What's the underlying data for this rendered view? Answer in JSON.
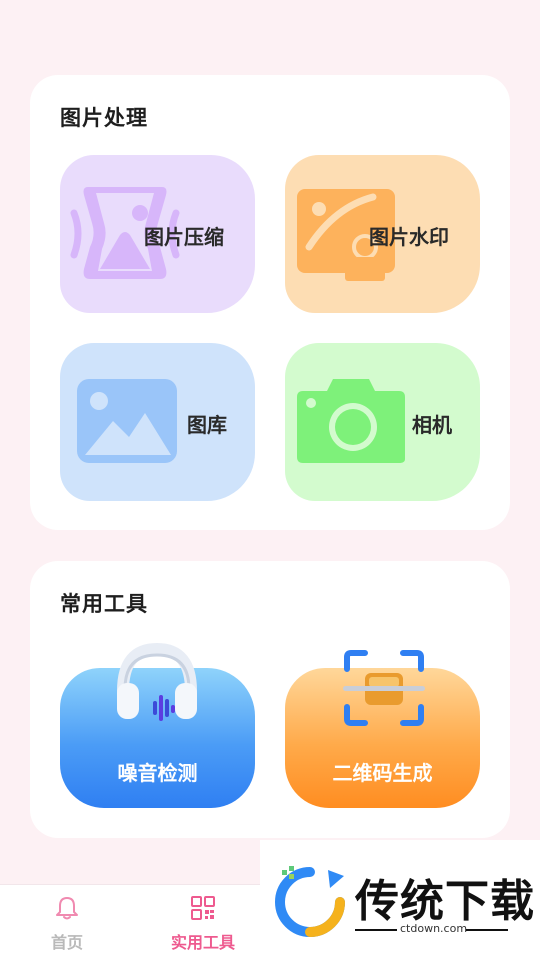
{
  "sections": {
    "image_processing": {
      "title": "图片处理",
      "tiles": [
        {
          "label": "图片压缩",
          "icon": "image-compress-icon"
        },
        {
          "label": "图片水印",
          "icon": "image-watermark-icon"
        },
        {
          "label": "图库",
          "icon": "gallery-icon"
        },
        {
          "label": "相机",
          "icon": "camera-icon"
        }
      ]
    },
    "common_tools": {
      "title": "常用工具",
      "tools": [
        {
          "label": "噪音检测",
          "icon": "headphones-icon"
        },
        {
          "label": "二维码生成",
          "icon": "qr-scan-icon"
        }
      ]
    }
  },
  "bottom_nav": {
    "items": [
      {
        "label": "首页",
        "icon": "bell-icon",
        "active": false
      },
      {
        "label": "实用工具",
        "icon": "qr-grid-icon",
        "active": true
      }
    ]
  },
  "watermark": {
    "brand": "传统下载",
    "domain": "ctdown.com"
  },
  "colors": {
    "background": "#fdf1f4",
    "active_nav": "#ee5a8f",
    "inactive_nav": "#b9b9b9",
    "tile_compress": "#e9dcfc",
    "tile_watermark": "#fdddb3",
    "tile_gallery": "#cfe3fb",
    "tile_camera": "#d3fbce"
  }
}
